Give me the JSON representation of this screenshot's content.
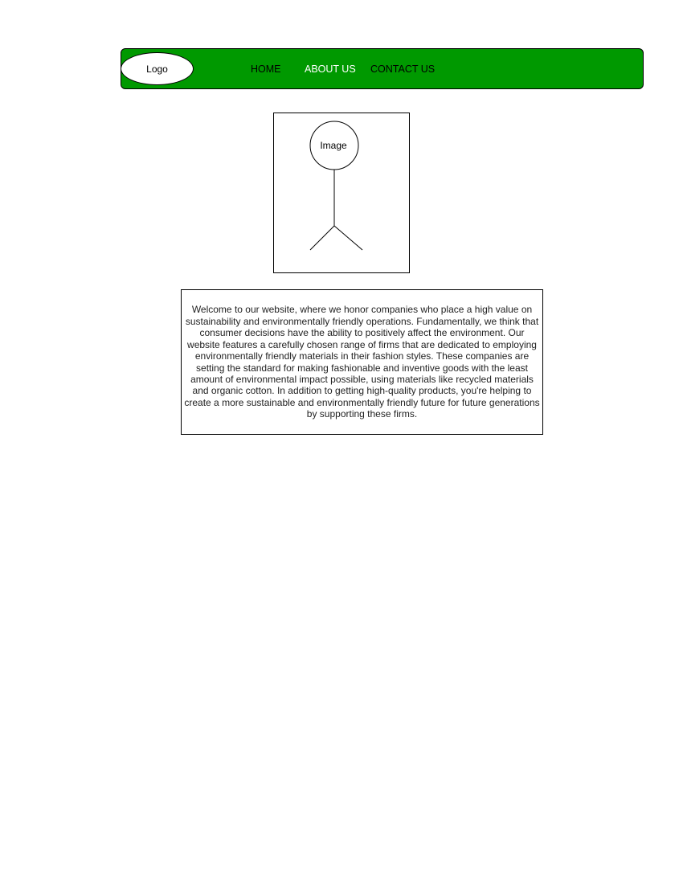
{
  "navbar": {
    "logo_label": "Logo",
    "links": [
      {
        "label": "HOME",
        "active": false
      },
      {
        "label": "ABOUT US",
        "active": true
      },
      {
        "label": "CONTACT US",
        "active": false
      }
    ],
    "background_color": "#009900",
    "active_link_color": "#ffffff"
  },
  "image": {
    "label": "Image",
    "icon": "stick-figure-icon"
  },
  "content": {
    "paragraph": "Welcome to our website, where we honor companies who place a high value on sustainability and environmentally friendly operations. Fundamentally, we think that consumer decisions have the ability to positively affect the environment. Our website features a carefully chosen range of firms that are dedicated to employing environmentally friendly materials in their fashion styles. These companies are setting the standard for making fashionable and inventive goods with the least amount of environmental impact possible, using materials like recycled materials and organic cotton. In addition to getting high-quality products, you're helping to create a more sustainable and environmentally friendly future for future generations by supporting these firms."
  }
}
